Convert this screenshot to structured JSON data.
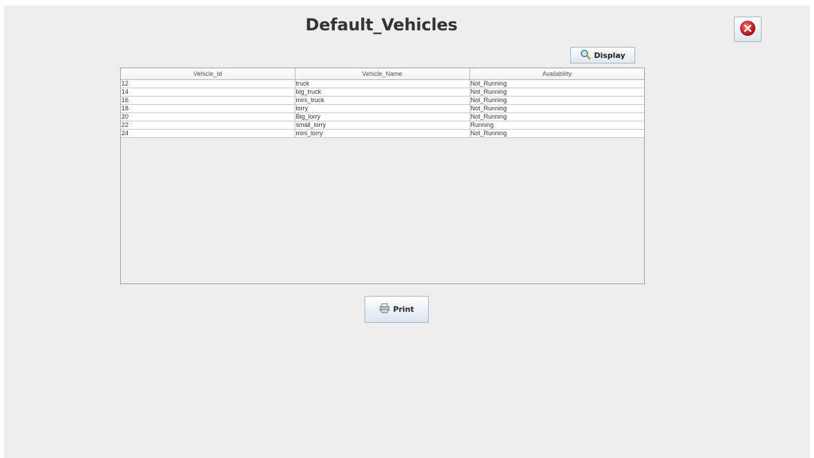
{
  "header": {
    "title": "Default_Vehicles"
  },
  "toolbar": {
    "display_label": "Display",
    "print_label": "Print"
  },
  "table": {
    "columns": [
      "Vehicle_Id",
      "Vehicle_Name",
      "Availability"
    ],
    "rows": [
      [
        "12",
        "truck",
        "Not_Running"
      ],
      [
        "14",
        "big_truck",
        "Not_Running"
      ],
      [
        "16",
        "mini_truck",
        "Not_Running"
      ],
      [
        "18",
        "lorry",
        "Not_Running"
      ],
      [
        "20",
        "Big_lorry",
        "Not_Running"
      ],
      [
        "22",
        "small_lorry",
        "Running"
      ],
      [
        "24",
        "mini_lorry",
        "Not_Running"
      ]
    ]
  },
  "icons": {
    "close": "close-icon",
    "display": "search-icon",
    "print": "printer-icon"
  },
  "colors": {
    "close_red": "#d9262c",
    "background": "#eeeeee"
  }
}
